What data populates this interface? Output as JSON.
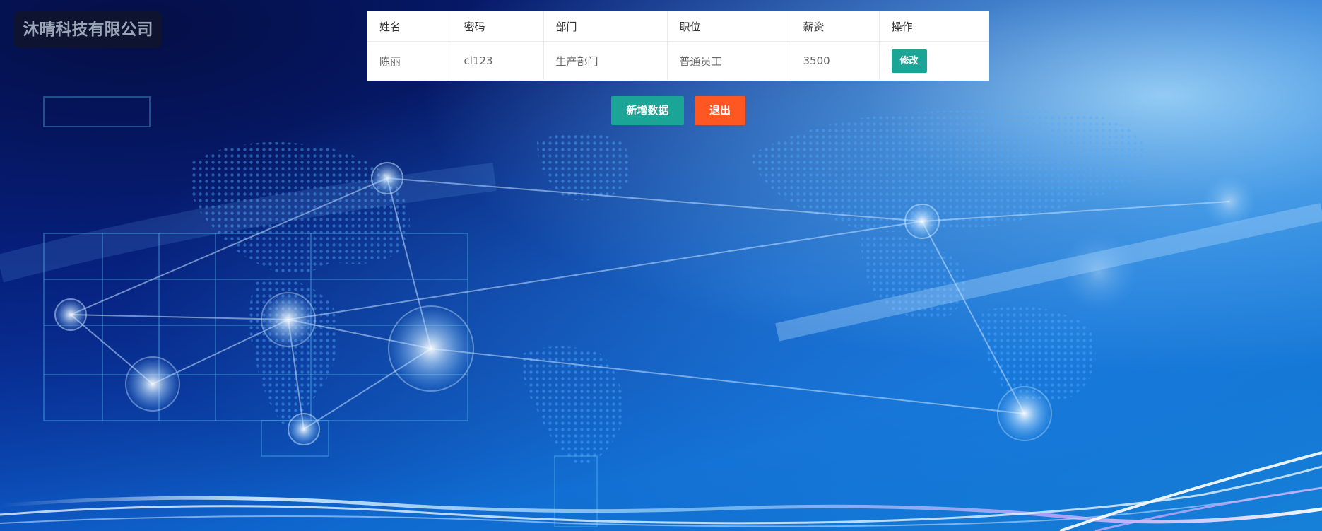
{
  "company": {
    "name": "沐晴科技有限公司"
  },
  "table": {
    "headers": [
      "姓名",
      "密码",
      "部门",
      "职位",
      "薪资",
      "操作"
    ],
    "rows": [
      {
        "name": "陈丽",
        "password": "cl123",
        "department": "生产部门",
        "position": "普通员工",
        "salary": "3500",
        "action_label": "修改"
      }
    ]
  },
  "actions": {
    "add_label": "新增数据",
    "exit_label": "退出"
  },
  "colors": {
    "primary": "#1aa597",
    "danger": "#ff5722",
    "panel": "#ffffff",
    "background_deep": "#06157a",
    "background_light": "#1680d8"
  }
}
